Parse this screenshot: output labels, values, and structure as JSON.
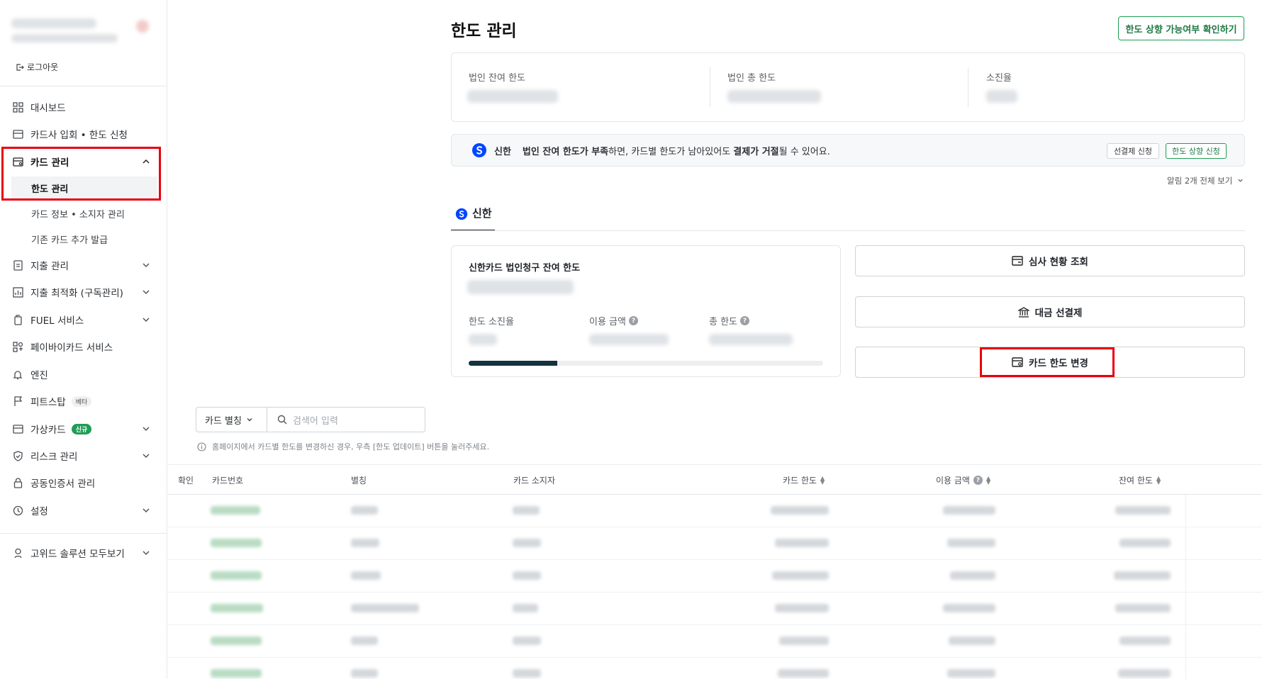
{
  "sidebar": {
    "logout": "로그아웃",
    "items": {
      "dashboard": "대시보드",
      "card_apply": "카드사 입회 • 한도 신청",
      "card_mgmt": "카드 관리",
      "limit_mgmt": "한도 관리",
      "card_info": "카드 정보 • 소지자 관리",
      "existing_card": "기존 카드 추가 발급",
      "expense": "지출 관리",
      "expense_opt": "지출 최적화 (구독관리)",
      "fuel": "FUEL 서비스",
      "paybuy": "페이바이카드 서비스",
      "engine": "엔진",
      "pitstop": "피트스탑",
      "pitstop_badge": "베타",
      "virtual_card": "가상카드",
      "virtual_card_badge": "신규",
      "risk": "리스크 관리",
      "cert": "공동인증서 관리",
      "settings": "설정",
      "all_solutions": "고위드 솔루션 모두보기"
    }
  },
  "header": {
    "title": "한도 관리",
    "check_button": "한도 상향 가능여부 확인하기"
  },
  "summary": {
    "remaining": "법인 잔여 한도",
    "total": "법인 총 한도",
    "exhaustion": "소진율"
  },
  "notice": {
    "bank": "신한",
    "text_bold1": "법인 잔여 한도가 부족",
    "text1": "하면, 카드별 한도가 남아있어도 ",
    "text_bold2": "결제가 거절",
    "text2": "될 수 있어요.",
    "prepay_button": "선결제 신청",
    "raise_button": "한도 상향 신청",
    "alarm_more": "알림 2개 전체 보기"
  },
  "tab": {
    "label": "신한"
  },
  "limit_card": {
    "title": "신한카드 법인청구 잔여 한도",
    "exhaustion": "한도 소진율",
    "used": "이용 금액",
    "total": "총 한도",
    "progress": 0.25
  },
  "actions": {
    "review": "심사 현황 조회",
    "prepay": "대금 선결제",
    "change": "카드 한도 변경"
  },
  "filter": {
    "select": "카드 별칭",
    "placeholder": "검색어 입력",
    "info": "홈페이지에서 카드별 한도를 변경하신 경우, 우측 [한도 업데이트] 버튼을 눌러주세요."
  },
  "table": {
    "columns": {
      "confirm": "확인",
      "card_number": "카드번호",
      "alias": "별칭",
      "holder": "카드 소지자",
      "limit": "카드 한도",
      "used": "이용 금액",
      "remaining": "잔여 한도"
    }
  },
  "colors": {
    "brand_green": "#1f9d55",
    "highlight_red": "#e8000b",
    "progress_dark": "#14323f",
    "shinhan_blue": "#0046ff"
  }
}
